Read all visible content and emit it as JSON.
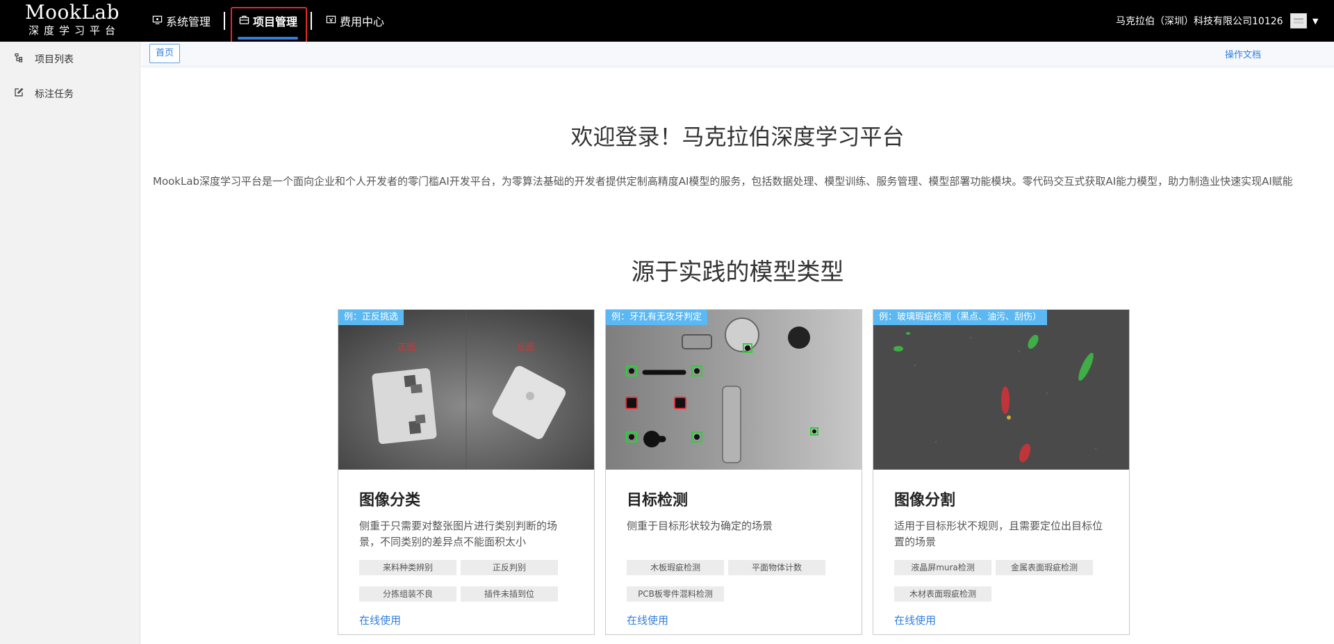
{
  "brand": {
    "title": "MookLab",
    "subtitle": "深度学习平台"
  },
  "nav": [
    {
      "label": "系统管理",
      "icon": "monitor-icon"
    },
    {
      "label": "项目管理",
      "icon": "briefcase-icon",
      "active": true
    },
    {
      "label": "费用中心",
      "icon": "bill-icon"
    }
  ],
  "user": {
    "company": "马克拉伯（深圳）科技有限公司10126"
  },
  "sidebar": {
    "items": [
      {
        "label": "项目列表",
        "icon": "project-list-icon"
      },
      {
        "label": "标注任务",
        "icon": "edit-icon"
      }
    ]
  },
  "tabs": {
    "home": "首页",
    "doc_link": "操作文档"
  },
  "main": {
    "welcome": "欢迎登录！马克拉伯深度学习平台",
    "intro": "MookLab深度学习平台是一个面向企业和个人开发者的零门槛AI开发平台，为零算法基础的开发者提供定制高精度AI模型的服务，包括数据处理、模型训练、服务管理、模型部署功能模块。零代码交互式获取AI能力模型，助力制造业快速实现AI赋能",
    "section_title": "源于实践的模型类型"
  },
  "cards": [
    {
      "tag": "例：正反挑选",
      "title": "图像分类",
      "desc": "侧重于只需要对整张图片进行类别判断的场景，不同类别的差异点不能面积太小",
      "chips": [
        "来料种类辨别",
        "正反判别",
        "分拣组装不良",
        "插件未插到位"
      ],
      "link": "在线使用",
      "labels": [
        "正面",
        "反面"
      ]
    },
    {
      "tag": "例：牙孔有无攻牙判定",
      "title": "目标检测",
      "desc": "侧重于目标形状较为确定的场景",
      "chips": [
        "木板瑕疵检测",
        "平面物体计数",
        "PCB板零件混料检测"
      ],
      "link": "在线使用"
    },
    {
      "tag": "例：玻璃瑕疵检测（黑点、油污、刮伤）",
      "title": "图像分割",
      "desc": "适用于目标形状不规则，且需要定位出目标位置的场景",
      "chips": [
        "液晶屏mura检测",
        "金属表面瑕疵检测",
        "木材表面瑕疵检测"
      ],
      "link": "在线使用"
    }
  ],
  "colors": {
    "accent": "#2f7fe0",
    "active_outline": "#e12b2b",
    "tag_bg": "#5bb8f2",
    "topbar": "#000000"
  }
}
